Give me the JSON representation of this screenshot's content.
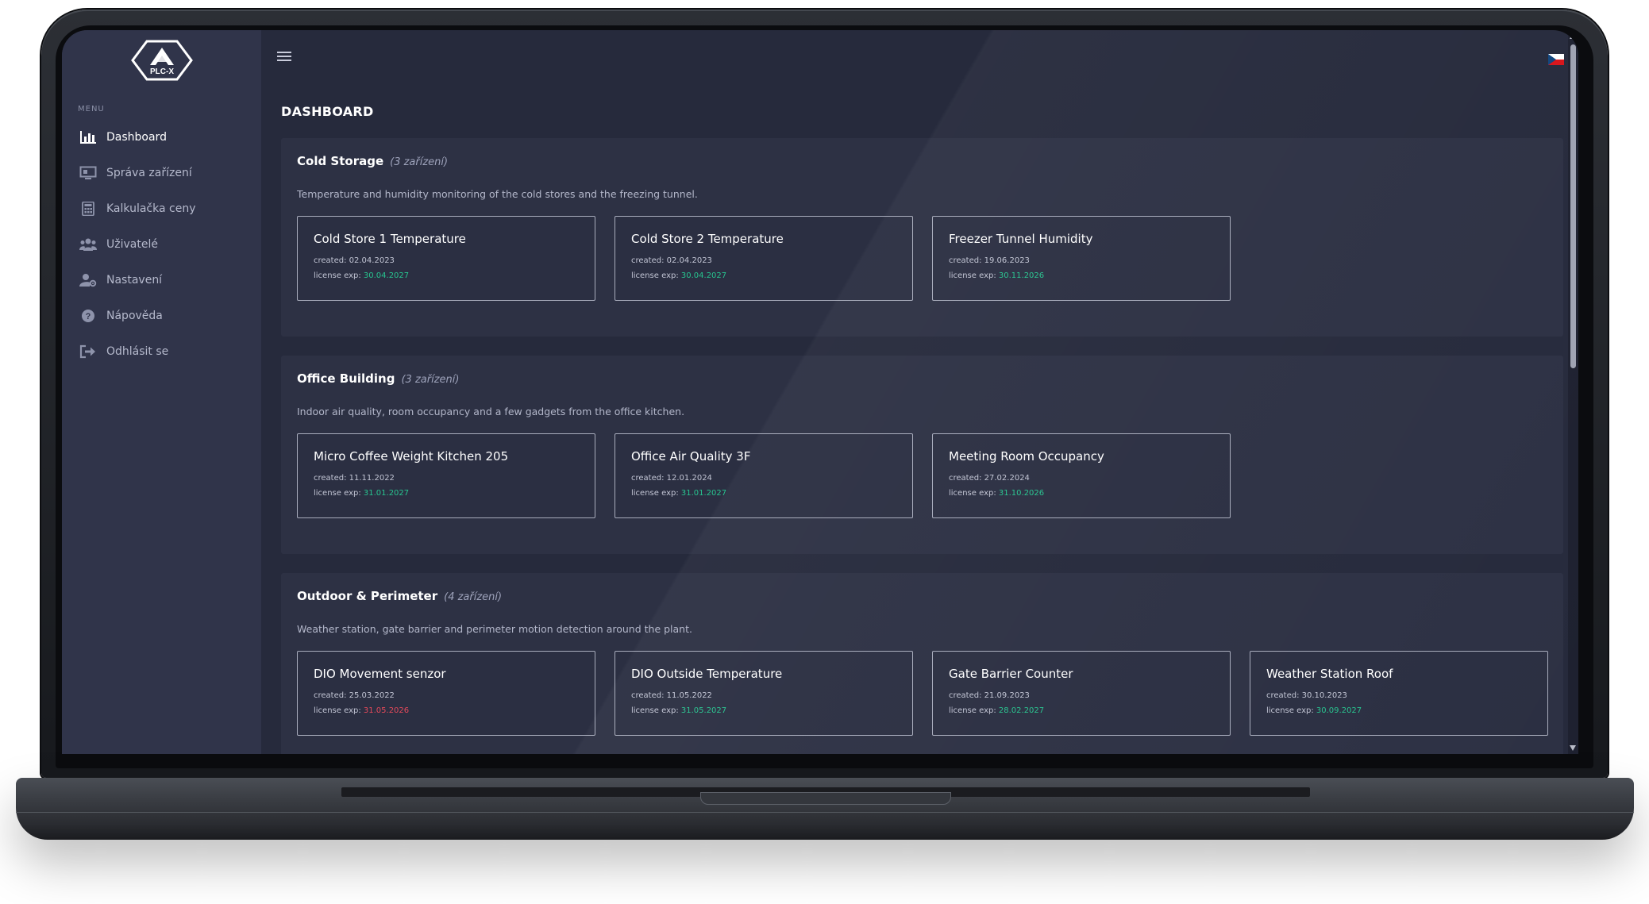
{
  "app": {
    "logo_text": "PLC-X",
    "language_flag": "cz-flag"
  },
  "sidebar": {
    "menu_heading": "MENU",
    "items": [
      {
        "label": "Dashboard",
        "icon": "bar-chart-icon",
        "active": true
      },
      {
        "label": "Správa zařízení",
        "icon": "monitor-icon"
      },
      {
        "label": "Kalkulačka ceny",
        "icon": "calculator-icon"
      },
      {
        "label": "Uživatelé",
        "icon": "users-icon"
      },
      {
        "label": "Nastavení",
        "icon": "user-gear-icon"
      },
      {
        "label": "Nápověda",
        "icon": "question-circle-icon"
      },
      {
        "label": "Odhlásit se",
        "icon": "logout-icon"
      }
    ]
  },
  "page": {
    "title": "DASHBOARD"
  },
  "labels": {
    "created": "created:",
    "license_exp": "license exp:"
  },
  "colors": {
    "license_valid": "#27c48f",
    "license_expiring": "#e4495a"
  },
  "groups": [
    {
      "title": "Cold Storage",
      "count": "(3 zařízení)",
      "description": "Temperature and humidity monitoring of the cold stores and the freezing tunnel.",
      "devices": [
        {
          "name": "Cold Store 1 Temperature",
          "created": "02.04.2023",
          "license_exp": "30.04.2027",
          "status": "ok"
        },
        {
          "name": "Cold Store 2 Temperature",
          "created": "02.04.2023",
          "license_exp": "30.04.2027",
          "status": "ok"
        },
        {
          "name": "Freezer Tunnel Humidity",
          "created": "19.06.2023",
          "license_exp": "30.11.2026",
          "status": "ok"
        }
      ]
    },
    {
      "title": "Office Building",
      "count": "(3 zařízení)",
      "description": "Indoor air quality, room occupancy and a few gadgets from the office kitchen.",
      "devices": [
        {
          "name": "Micro Coffee Weight Kitchen 205",
          "created": "11.11.2022",
          "license_exp": "31.01.2027",
          "status": "ok"
        },
        {
          "name": "Office Air Quality 3F",
          "created": "12.01.2024",
          "license_exp": "31.01.2027",
          "status": "ok"
        },
        {
          "name": "Meeting Room Occupancy",
          "created": "27.02.2024",
          "license_exp": "31.10.2026",
          "status": "ok"
        }
      ]
    },
    {
      "title": "Outdoor & Perimeter",
      "count": "(4 zařízení)",
      "description": "Weather station, gate barrier and perimeter motion detection around the plant.",
      "devices": [
        {
          "name": "DIO Movement senzor",
          "created": "25.03.2022",
          "license_exp": "31.05.2026",
          "status": "expiring"
        },
        {
          "name": "DIO Outside Temperature",
          "created": "11.05.2022",
          "license_exp": "31.05.2027",
          "status": "ok"
        },
        {
          "name": "Gate Barrier Counter",
          "created": "21.09.2023",
          "license_exp": "28.02.2027",
          "status": "ok"
        },
        {
          "name": "Weather Station Roof",
          "created": "30.10.2023",
          "license_exp": "30.09.2027",
          "status": "ok"
        }
      ]
    }
  ]
}
